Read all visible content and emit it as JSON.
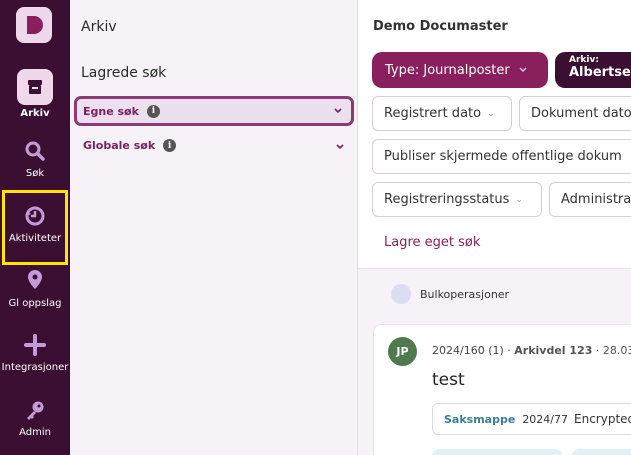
{
  "nav": {
    "items": [
      {
        "label": "Arkiv",
        "icon": "archive-box-icon"
      },
      {
        "label": "Søk",
        "icon": "search-icon"
      },
      {
        "label": "Aktiviteter",
        "icon": "activity-clock-icon"
      },
      {
        "label": "Gl oppslag",
        "icon": "location-pin-icon"
      },
      {
        "label": "Integrasjoner",
        "icon": "plus-icon"
      },
      {
        "label": "Admin",
        "icon": "key-icon"
      }
    ]
  },
  "archive_panel": {
    "title": "Arkiv",
    "saved_title": "Lagrede søk",
    "egne_label": "Egne søk",
    "globale_label": "Globale søk",
    "info_glyph": "i"
  },
  "main": {
    "title": "Demo Documaster",
    "type_filter": "Type: Journalposter",
    "arkiv_filter": {
      "key": "Arkiv:",
      "value": "Albertsen"
    },
    "filters": {
      "registrert_dato": "Registrert dato",
      "dokument_dato": "Dokument dato",
      "publiser": "Publiser skjermede offentlige dokum",
      "registreringsstatus": "Registreringsstatus",
      "administrativ": "Administra"
    },
    "save_search": "Lagre eget søk",
    "bulk_label": "Bulkoperasjoner",
    "card": {
      "initials": "JP",
      "number": "2024/160 (1)",
      "sep": "·",
      "arkivdel": "Arkivdel 123",
      "date": "28.03",
      "title": "test",
      "saksmappe_label": "Saksmappe",
      "saksmappe_number": "2024/77",
      "saksmappe_text": "Encrypted"
    }
  },
  "colors": {
    "rail": "#3b0f32",
    "accent": "#8a1f5e",
    "highlight": "#ffe600",
    "avatar": "#4f7a4d"
  }
}
